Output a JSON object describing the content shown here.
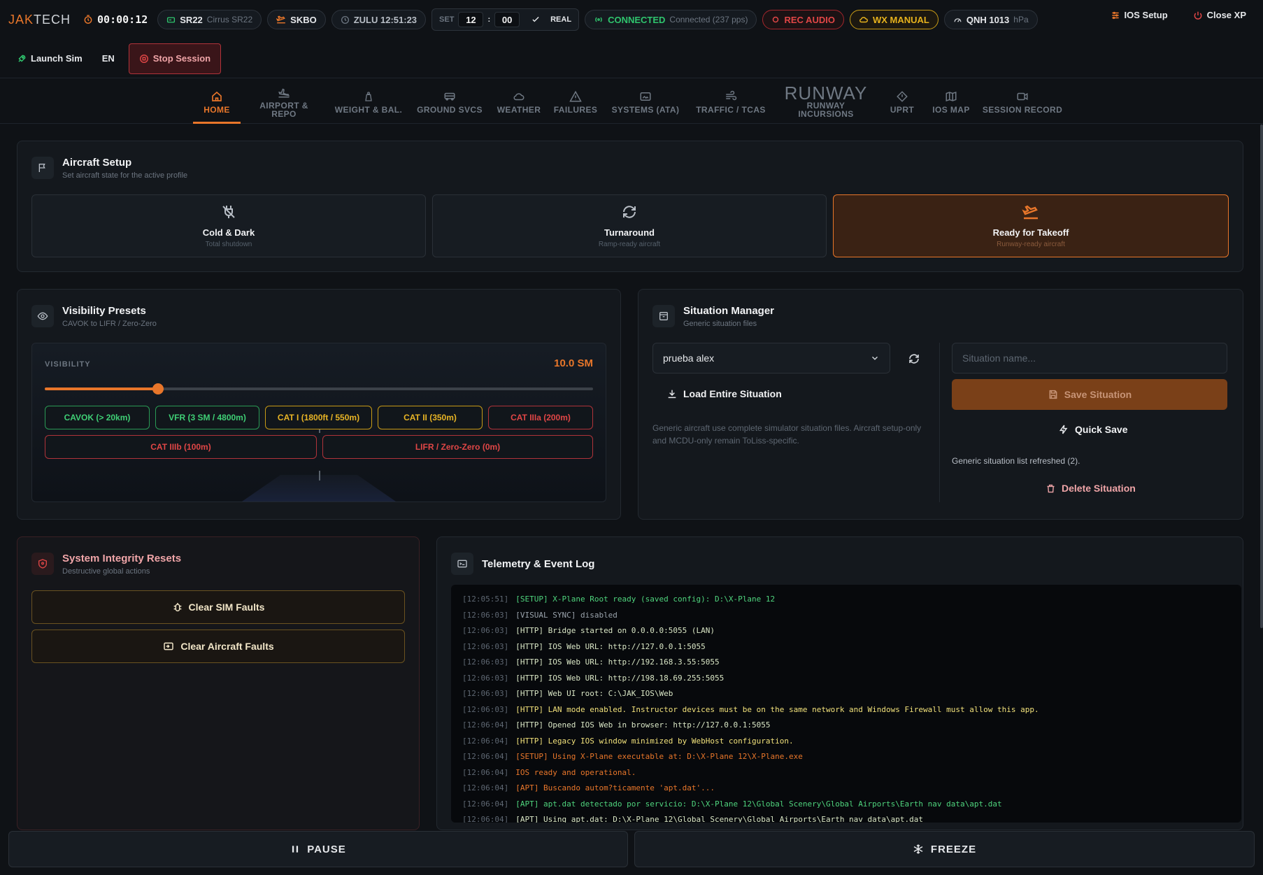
{
  "topbar": {
    "logo_a": "JAK",
    "logo_b": "TECH",
    "timer": "00:00:12",
    "aircraft_code": "SR22",
    "aircraft_name": "Cirrus SR22",
    "airport": "SKBO",
    "zulu": "ZULU 12:51:23",
    "set_label": "SET",
    "set_hour": "12",
    "set_sep": ":",
    "set_min": "00",
    "real_label": "REAL",
    "connected": "CONNECTED",
    "connected_detail": "Connected (237 pps)",
    "rec_audio": "REC AUDIO",
    "wx_manual": "WX MANUAL",
    "qnh": "QNH 1013",
    "qnh_unit": "hPa",
    "ios_setup": "IOS Setup",
    "close_xp": "Close XP"
  },
  "secondbar": {
    "launch_sim": "Launch Sim",
    "language": "EN",
    "stop_session": "Stop Session"
  },
  "nav": {
    "tabs": [
      {
        "label": "HOME"
      },
      {
        "label": "AIRPORT & REPO"
      },
      {
        "label": "WEIGHT & BAL."
      },
      {
        "label": "GROUND SVCS"
      },
      {
        "label": "WEATHER"
      },
      {
        "label": "FAILURES"
      },
      {
        "label": "SYSTEMS (ATA)"
      },
      {
        "label": "TRAFFIC / TCAS"
      },
      {
        "label": "RUNWAY",
        "label2": "RUNWAY",
        "label3": "INCURSIONS"
      },
      {
        "label": "UPRT"
      },
      {
        "label": "IOS MAP"
      },
      {
        "label": "SESSION RECORD"
      }
    ]
  },
  "aircraft_setup": {
    "title": "Aircraft Setup",
    "subtitle": "Set aircraft state for the active profile",
    "states": [
      {
        "title": "Cold & Dark",
        "sub": "Total shutdown"
      },
      {
        "title": "Turnaround",
        "sub": "Ramp-ready aircraft"
      },
      {
        "title": "Ready for Takeoff",
        "sub": "Runway-ready aircraft"
      }
    ]
  },
  "visibility": {
    "title": "Visibility Presets",
    "subtitle": "CAVOK to LIFR / Zero-Zero",
    "label": "VISIBILITY",
    "value": "10.0 SM",
    "slider_fraction": 0.206,
    "presets": [
      "CAVOK (> 20km)",
      "VFR (3 SM / 4800m)",
      "CAT I (1800ft / 550m)",
      "CAT II (350m)",
      "CAT IIIa (200m)",
      "CAT IIIb (100m)",
      "LIFR / Zero-Zero (0m)"
    ]
  },
  "situation": {
    "title": "Situation Manager",
    "subtitle": "Generic situation files",
    "selected": "prueba alex",
    "load": "Load Entire Situation",
    "note": "Generic aircraft use complete simulator situation files. Aircraft setup-only and MCDU-only remain ToLiss-specific.",
    "name_placeholder": "Situation name...",
    "save": "Save Situation",
    "quick_save": "Quick Save",
    "status": "Generic situation list refreshed (2).",
    "delete": "Delete Situation"
  },
  "resets": {
    "title": "System Integrity Resets",
    "subtitle": "Destructive global actions",
    "clear_sim": "Clear SIM Faults",
    "clear_aircraft": "Clear Aircraft Faults"
  },
  "log": {
    "title": "Telemetry & Event Log",
    "lines": [
      {
        "ts": "[12:05:51]",
        "msg": "[SETUP] X-Plane Root ready (saved config): D:\\X-Plane 12",
        "color": "green"
      },
      {
        "ts": "[12:06:03]",
        "msg": "[VISUAL SYNC] disabled",
        "color": "gray"
      },
      {
        "ts": "[12:06:03]",
        "msg": "[HTTP] Bridge started on 0.0.0.0:5055 (LAN)",
        "color": "light"
      },
      {
        "ts": "[12:06:03]",
        "msg": "[HTTP] IOS Web URL: http://127.0.0.1:5055",
        "color": "light"
      },
      {
        "ts": "[12:06:03]",
        "msg": "[HTTP] IOS Web URL: http://192.168.3.55:5055",
        "color": "light"
      },
      {
        "ts": "[12:06:03]",
        "msg": "[HTTP] IOS Web URL: http://198.18.69.255:5055",
        "color": "light"
      },
      {
        "ts": "[12:06:03]",
        "msg": "[HTTP] Web UI root: C:\\JAK_IOS\\Web",
        "color": "light"
      },
      {
        "ts": "[12:06:03]",
        "msg": "[HTTP] LAN mode enabled. Instructor devices must be on the same network and Windows Firewall must allow this app.",
        "color": "yellow"
      },
      {
        "ts": "[12:06:04]",
        "msg": "[HTTP] Opened IOS Web in browser: http://127.0.0.1:5055",
        "color": "light"
      },
      {
        "ts": "[12:06:04]",
        "msg": "[HTTP] Legacy IOS window minimized by WebHost configuration.",
        "color": "yellow"
      },
      {
        "ts": "[12:06:04]",
        "msg": "[SETUP] Using X-Plane executable at: D:\\X-Plane 12\\X-Plane.exe",
        "color": "orange"
      },
      {
        "ts": "[12:06:04]",
        "msg": "IOS ready and operational.",
        "color": "orange"
      },
      {
        "ts": "[12:06:04]",
        "msg": "[APT] Buscando autom?ticamente 'apt.dat'...",
        "color": "orange"
      },
      {
        "ts": "[12:06:04]",
        "msg": "[APT] apt.dat detectado por servicio: D:\\X-Plane 12\\Global Scenery\\Global Airports\\Earth nav data\\apt.dat",
        "color": "green"
      },
      {
        "ts": "[12:06:04]",
        "msg": "[APT] Using apt.dat: D:\\X-Plane 12\\Global Scenery\\Global Airports\\Earth nav data\\apt.dat",
        "color": "light"
      }
    ]
  },
  "bottom": {
    "pause": "PAUSE",
    "freeze": "FREEZE"
  },
  "colors": {
    "accent": "#e8762a",
    "connected": "#2fc46d",
    "rec": "#e04646",
    "wx": "#e6b21d"
  }
}
